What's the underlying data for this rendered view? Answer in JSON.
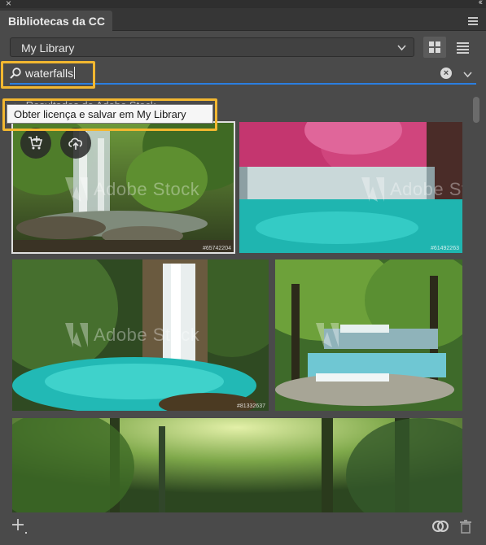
{
  "panel": {
    "title": "Bibliotecas da CC",
    "close_glyph": "×",
    "collapse_glyph": "‹‹"
  },
  "library": {
    "selected": "My Library"
  },
  "search": {
    "query": "waterfalls"
  },
  "results": {
    "section_label": "Resultados do Adobe Stock"
  },
  "tooltip": {
    "text": "Obter licença e salvar em My Library"
  },
  "watermark": "Adobe Stock",
  "images": [
    {
      "id": "#65742204",
      "label": "waterfall-forest"
    },
    {
      "id": "#61492263",
      "label": "turquoise-cascade-pink-trees"
    },
    {
      "id": "#81332637",
      "label": "waterfall-turquoise-pool"
    },
    {
      "id": "",
      "label": "jungle-terraced-falls"
    },
    {
      "id": "",
      "label": "green-forest-path"
    }
  ],
  "icons": {
    "search": "search-icon",
    "clear": "clear-search-icon",
    "dropdown": "chevron-down-icon",
    "grid": "grid-view-icon",
    "list": "list-view-icon",
    "license": "cart-plus-icon",
    "save": "cloud-upload-icon",
    "add": "plus-icon",
    "cc_sync": "creative-cloud-icon",
    "trash": "trash-icon"
  },
  "colors": {
    "accent": "#2b7fe0",
    "highlight": "#f2b730",
    "panel_bg": "#4a4a4a"
  }
}
